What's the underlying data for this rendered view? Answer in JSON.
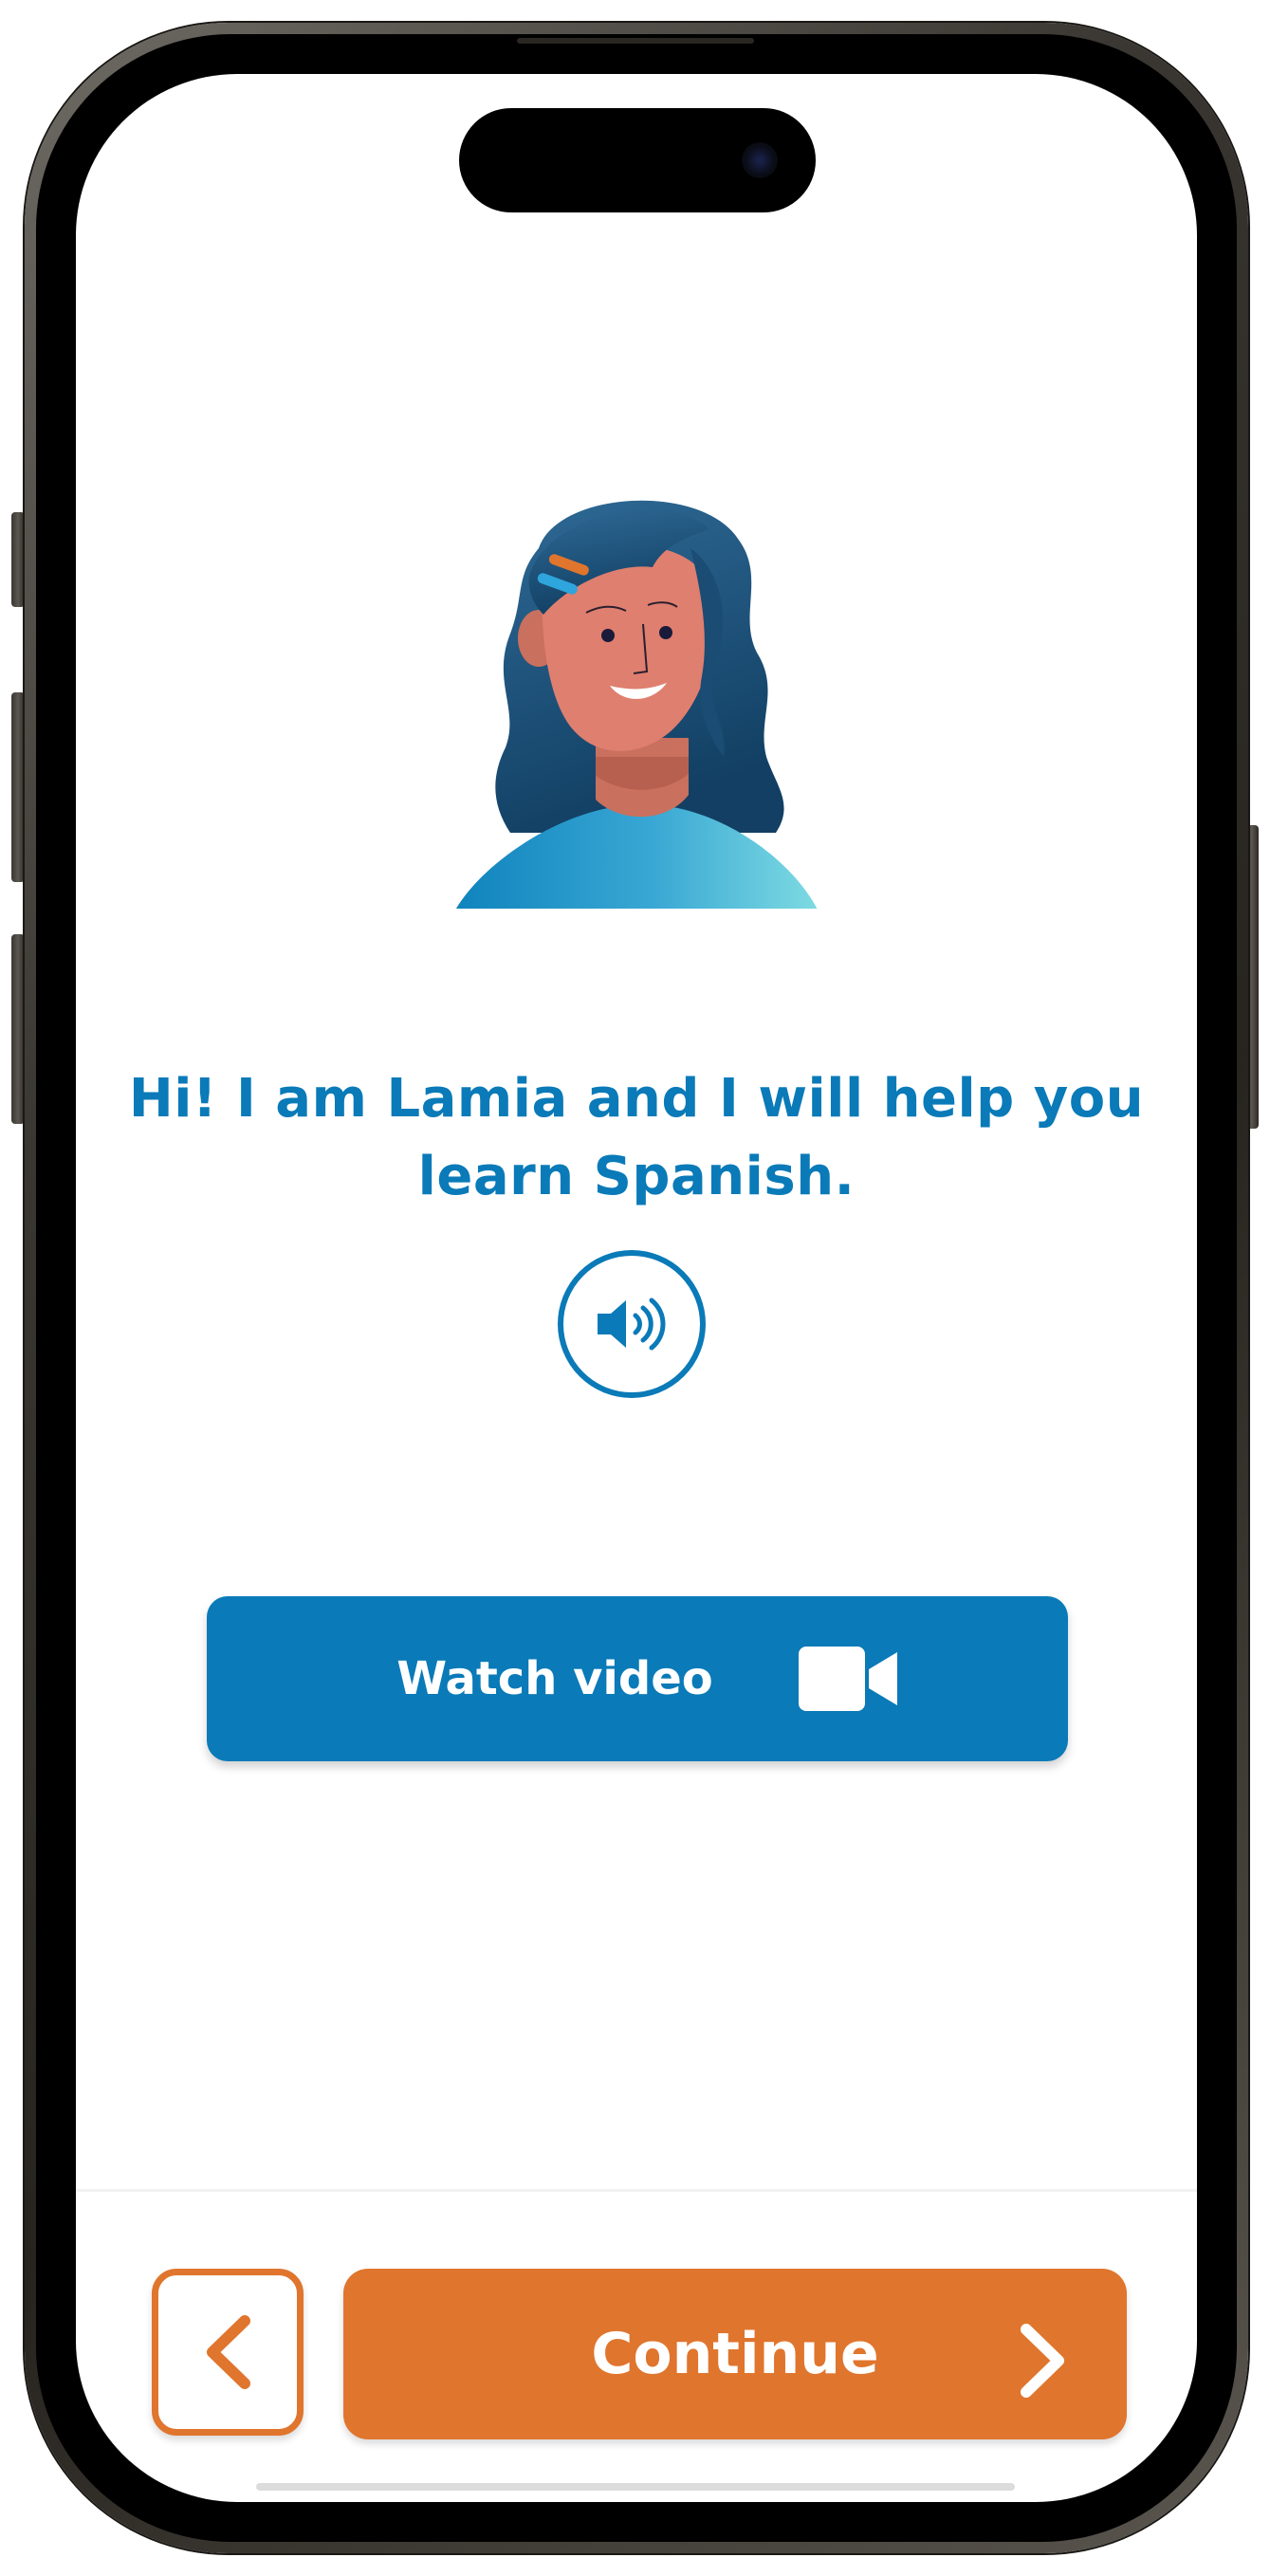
{
  "lesson": {
    "greeting_line1": "Hi! I am Lamia and I will help you",
    "greeting_line2": "learn Spanish.",
    "audio_icon": "speaker-icon",
    "watch_video_label": "Watch video",
    "video_icon": "video-camera-icon"
  },
  "navigation": {
    "back_icon": "chevron-left-icon",
    "continue_label": "Continue",
    "continue_icon": "chevron-right-icon"
  },
  "colors": {
    "primary_blue": "#0a7ab8",
    "accent_orange": "#e0752d",
    "background": "#ffffff"
  }
}
